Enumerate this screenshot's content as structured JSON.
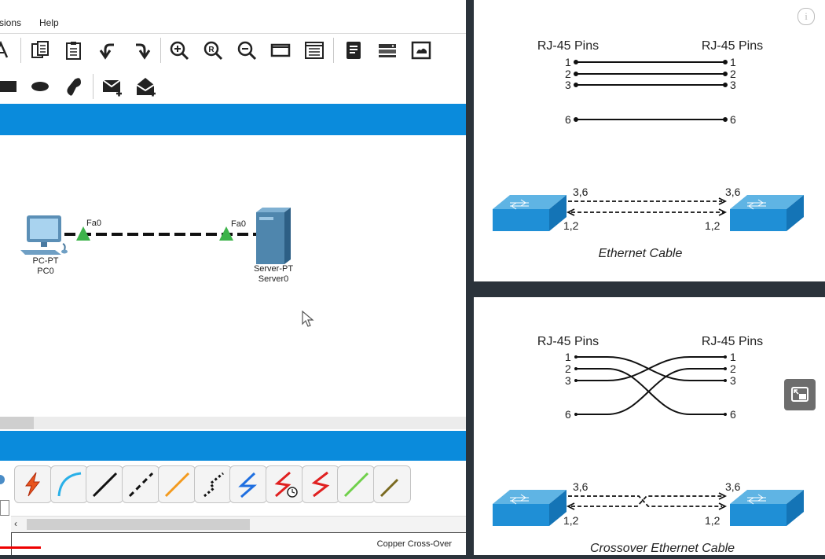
{
  "menu": {
    "extensions": "sions",
    "help": "Help"
  },
  "toolbar_row1": [
    "inspect-icon",
    "copy-icon",
    "paste-icon",
    "undo-icon",
    "redo-icon",
    "zoom-in-icon",
    "zoom-reset-icon",
    "zoom-out-icon",
    "drawing-palette-icon",
    "custom-device-icon",
    "notes-icon",
    "pdu-list-icon",
    "image-icon"
  ],
  "toolbar_row2": [
    "rectangle-icon",
    "ellipse-icon",
    "freeform-icon",
    "simple-pdu-icon",
    "complex-pdu-icon"
  ],
  "topology": {
    "pc": {
      "type": "PC-PT",
      "name": "PC0",
      "port": "Fa0"
    },
    "server": {
      "type": "Server-PT",
      "name": "Server0",
      "port": "Fa0"
    },
    "link_color": "#111111",
    "port_color": "#3db34a"
  },
  "cable_palette": {
    "status_label": "Copper Cross-Over",
    "items": [
      {
        "name": "automatic-cable-icon",
        "color": "#e8541e"
      },
      {
        "name": "console-cable-icon",
        "color": "#2ab0e8"
      },
      {
        "name": "copper-straight-through-icon",
        "color": "#111111"
      },
      {
        "name": "copper-cross-over-icon",
        "color": "#111111"
      },
      {
        "name": "fiber-cable-icon",
        "color": "#f39a1e"
      },
      {
        "name": "phone-cable-icon",
        "color": "#111111"
      },
      {
        "name": "coaxial-cable-icon",
        "color": "#1f6fe0"
      },
      {
        "name": "serial-dce-icon",
        "color": "#e02020"
      },
      {
        "name": "serial-dte-icon",
        "color": "#e02020"
      },
      {
        "name": "octal-cable-icon",
        "color": "#6fd04a"
      },
      {
        "name": "iot-custom-cable-icon",
        "color": "#7a6a20"
      }
    ]
  },
  "video": {
    "progress": 0.088
  },
  "straight_diagram": {
    "left_heading": "RJ-45 Pins",
    "right_heading": "RJ-45 Pins",
    "pins": [
      "1",
      "2",
      "3",
      "6"
    ],
    "switch_top_label_left": "3,6",
    "switch_top_label_right": "3,6",
    "switch_bottom_label_left": "1,2",
    "switch_bottom_label_right": "1,2",
    "caption": "Ethernet Cable"
  },
  "crossover_diagram": {
    "left_heading": "RJ-45 Pins",
    "right_heading": "RJ-45 Pins",
    "pins": [
      "1",
      "2",
      "3",
      "6"
    ],
    "switch_top_label_left": "3,6",
    "switch_top_label_right": "3,6",
    "switch_bottom_label_left": "1,2",
    "switch_bottom_label_right": "1,2",
    "caption": "Crossover Ethernet Cable"
  },
  "overlay": {
    "info_icon": "info-icon",
    "pip_icon": "picture-in-picture-icon"
  }
}
